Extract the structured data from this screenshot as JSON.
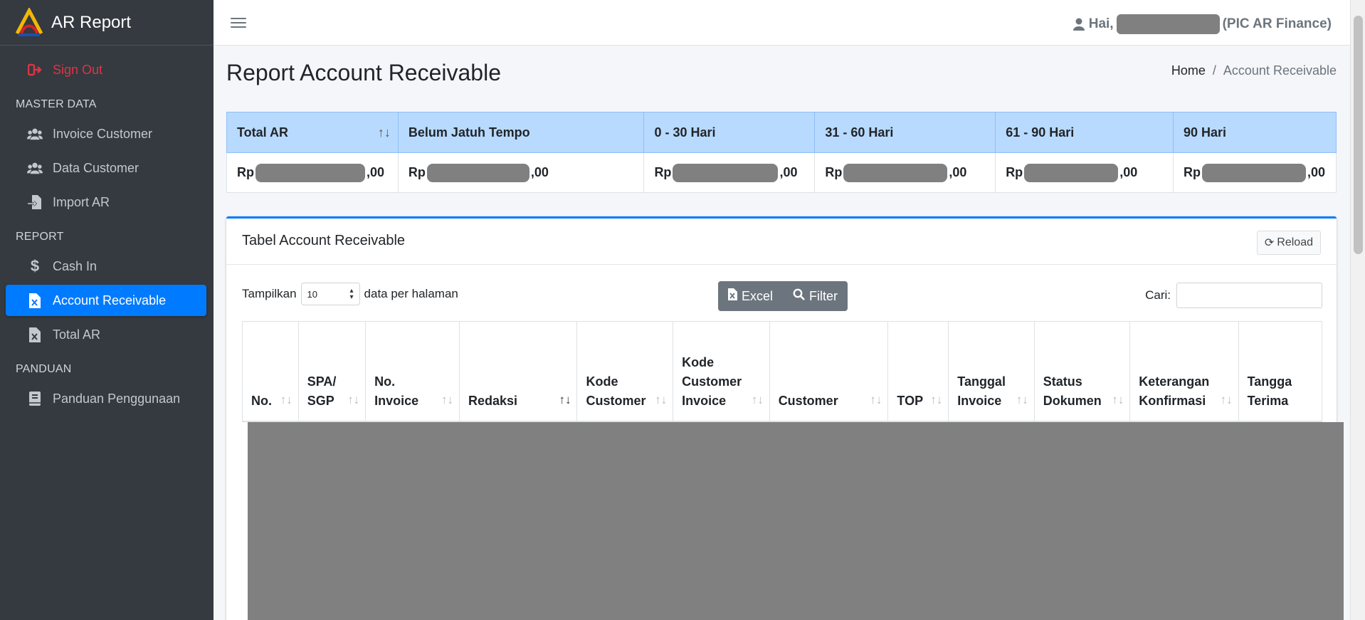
{
  "app": {
    "title": "AR Report"
  },
  "sidebar": {
    "signout": "Sign Out",
    "sections": [
      {
        "header": "MASTER DATA",
        "items": [
          {
            "label": "Invoice Customer",
            "icon": "users-icon"
          },
          {
            "label": "Data Customer",
            "icon": "users-icon"
          },
          {
            "label": "Import AR",
            "icon": "file-import-icon"
          }
        ]
      },
      {
        "header": "REPORT",
        "items": [
          {
            "label": "Cash In",
            "icon": "dollar-icon"
          },
          {
            "label": "Account Receivable",
            "icon": "file-excel-icon",
            "active": true
          },
          {
            "label": "Total AR",
            "icon": "file-excel-icon"
          }
        ]
      },
      {
        "header": "PANDUAN",
        "items": [
          {
            "label": "Panduan Penggunaan",
            "icon": "book-icon"
          }
        ]
      }
    ]
  },
  "topbar": {
    "greeting": "Hai,",
    "role": "(PIC AR Finance)"
  },
  "page": {
    "title": "Report Account Receivable"
  },
  "breadcrumb": {
    "home": "Home",
    "separator": "/",
    "current": "Account Receivable"
  },
  "summary": {
    "headers": [
      "Total AR",
      "Belum Jatuh Tempo",
      "0 - 30 Hari",
      "31 - 60 Hari",
      "61 - 90 Hari",
      "90 Hari"
    ],
    "currency": "Rp",
    "suffix": ",00",
    "sort_icon": "↑↓"
  },
  "card": {
    "title": "Tabel Account Receivable",
    "reload": "Reload",
    "show_prefix": "Tampilkan",
    "page_size": "10",
    "show_suffix": "data per halaman",
    "excel": "Excel",
    "filter": "Filter",
    "search_label": "Cari:",
    "search_value": ""
  },
  "table": {
    "columns": [
      {
        "lines": [
          "No."
        ]
      },
      {
        "lines": [
          "SPA/",
          "SGP"
        ]
      },
      {
        "lines": [
          "No.",
          "Invoice"
        ]
      },
      {
        "lines": [
          "Redaksi"
        ]
      },
      {
        "lines": [
          "Kode",
          "Customer"
        ]
      },
      {
        "lines": [
          "Kode",
          "Customer",
          "Invoice"
        ]
      },
      {
        "lines": [
          "Customer"
        ]
      },
      {
        "lines": [
          "TOP"
        ]
      },
      {
        "lines": [
          "Tanggal",
          "Invoice"
        ]
      },
      {
        "lines": [
          "Status",
          "Dokumen"
        ]
      },
      {
        "lines": [
          "Keterangan",
          "Konfirmasi"
        ]
      },
      {
        "lines": [
          "Tangga",
          "Terima"
        ]
      }
    ]
  },
  "colors": {
    "sidebar_bg": "#343a40",
    "active": "#007bff",
    "summary_header": "#b8daff",
    "danger": "#dc3545"
  }
}
